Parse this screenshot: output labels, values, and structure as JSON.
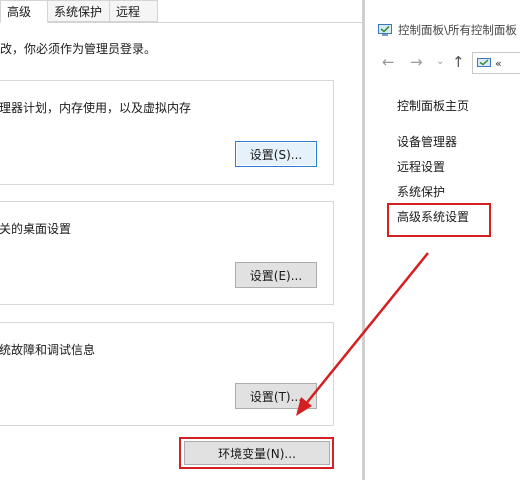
{
  "system_properties": {
    "tabs": [
      {
        "label": "高级"
      },
      {
        "label": "系统保护"
      },
      {
        "label": "远程"
      }
    ],
    "admin_note": "改，你必须作为管理员登录。",
    "groups": [
      {
        "description": "理器计划，内存使用，以及虚拟内存",
        "button_label": "设置(S)..."
      },
      {
        "description": "关的桌面设置",
        "button_label": "设置(E)..."
      },
      {
        "description": "统故障和调试信息",
        "button_label": "设置(T)..."
      }
    ],
    "env_button_label": "环境变量(N)..."
  },
  "control_panel": {
    "title": "控制面板\\所有控制面板",
    "address_text": "«",
    "home_link": "控制面板主页",
    "links": [
      "设备管理器",
      "远程设置",
      "系统保护",
      "高级系统设置"
    ]
  },
  "annotations": {
    "color": "#d42020"
  }
}
